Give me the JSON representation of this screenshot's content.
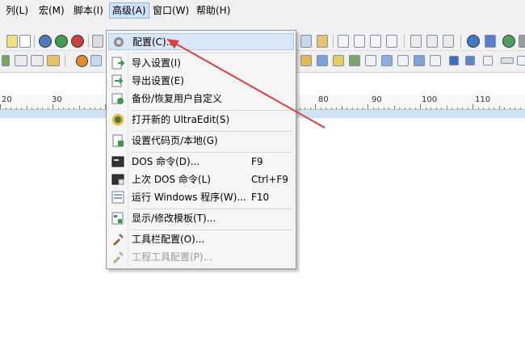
{
  "menubar": {
    "items": [
      {
        "label": "列(L)"
      },
      {
        "label": "宏(M)"
      },
      {
        "label": "脚本(I)"
      },
      {
        "label": "高级(A)"
      },
      {
        "label": "窗口(W)"
      },
      {
        "label": "帮助(H)"
      }
    ]
  },
  "ruler": {
    "numbers": [
      "20",
      "30",
      "80",
      "90",
      "100",
      "110"
    ]
  },
  "dropdown": {
    "items": [
      {
        "label": "配置(C)...",
        "shortcut": "",
        "icon": "gear-icon"
      },
      {
        "label": "导入设置(I)",
        "shortcut": "",
        "icon": "import-icon"
      },
      {
        "label": "导出设置(E)",
        "shortcut": "",
        "icon": "export-icon"
      },
      {
        "label": "备份/恢复用户自定义",
        "shortcut": "",
        "icon": "backup-icon"
      },
      {
        "label": "打开新的 UltraEdit(S)",
        "shortcut": "",
        "icon": "ultraedit-icon"
      },
      {
        "label": "设置代码页/本地(G)",
        "shortcut": "",
        "icon": "codepage-icon"
      },
      {
        "label": "DOS 命令(D)...",
        "shortcut": "F9",
        "icon": "dos-icon"
      },
      {
        "label": "上次 DOS 命令(L)",
        "shortcut": "Ctrl+F9",
        "icon": "last-dos-icon"
      },
      {
        "label": "运行 Windows 程序(W)...",
        "shortcut": "F10",
        "icon": "run-program-icon"
      },
      {
        "label": "显示/修改模板(T)...",
        "shortcut": "",
        "icon": "template-icon"
      },
      {
        "label": "工具栏配置(O)...",
        "shortcut": "",
        "icon": "toolbar-config-icon"
      },
      {
        "label": "工程工具配置(P)...",
        "shortcut": "",
        "icon": "project-tool-icon"
      }
    ]
  },
  "colors": {
    "arrow": "#d9413f",
    "highlight": "#d8e6f7",
    "menu_bg": "#f5f5f5",
    "ruler_bar": "#cfe1f3"
  }
}
